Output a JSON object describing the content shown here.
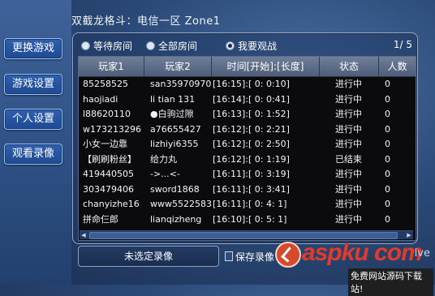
{
  "title": "双截龙格斗：电信一区 Zone1",
  "nav": [
    {
      "label": "更换游戏"
    },
    {
      "label": "游戏设置"
    },
    {
      "label": "个人设置"
    },
    {
      "label": "观看录像"
    }
  ],
  "filters": [
    {
      "label": "等待房间",
      "checked": false
    },
    {
      "label": "全部房间",
      "checked": false
    },
    {
      "label": "我要观战",
      "checked": true
    }
  ],
  "page_indicator": "1/  5",
  "table": {
    "headers": [
      "玩家1",
      "玩家2",
      "时间[开始]:[长度]",
      "状态",
      "人数"
    ],
    "rows": [
      [
        "85258525",
        "san35970970",
        "[16:15]:[ 0: 0:10]",
        "进行中",
        "0"
      ],
      [
        "haojiadi",
        "li tian 131",
        "[16:14]:[ 0: 0:41]",
        "进行中",
        "0"
      ],
      [
        "l88620110",
        "●白驹过隙",
        "[16:13]:[ 0: 1:52]",
        "进行中",
        "0"
      ],
      [
        "w173213296",
        "a76655427",
        "[16:12]:[ 0: 2:21]",
        "进行中",
        "0"
      ],
      [
        "小女一边靠",
        "lizhiyi6355",
        "[16:12]:[ 0: 2:50]",
        "进行中",
        "0"
      ],
      [
        "【刷刷粉丝】",
        "给力丸",
        "[16:12]:[ 0: 1:19]",
        "已结束",
        "0"
      ],
      [
        "419440505",
        "->...<-",
        "[16:11]:[ 0: 3:19]",
        "进行中",
        "0"
      ],
      [
        "303479406",
        "sword1868",
        "[16:11]:[ 0: 3:41]",
        "进行中",
        "0"
      ],
      [
        "chanyizhe16",
        "www5522583",
        "[16:11]:[ 0: 4: 1]",
        "进行中",
        "0"
      ],
      [
        "拼命仨郎",
        "lianqizheng",
        "[16:10]:[ 0: 5: 1]",
        "进行中",
        "0"
      ]
    ]
  },
  "replay_field": "未选定录像",
  "save_button": "保存录像",
  "watermark": {
    "word": "aspku",
    "dot": ".",
    "suffix": "com",
    "tagline": "免费网站源码下载站!",
    "live": "ive"
  }
}
